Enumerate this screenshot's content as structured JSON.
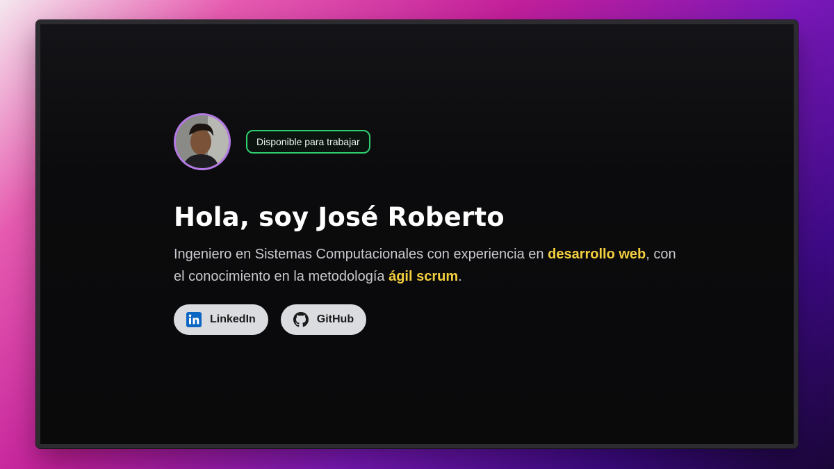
{
  "hero": {
    "availability_badge": "Disponible para trabajar",
    "title": "Hola, soy José Roberto",
    "description": {
      "part1": "Ingeniero en Sistemas Computacionales con experiencia en ",
      "highlight1": "desarrollo web",
      "part2": ", con el conocimiento en la metodología ",
      "highlight2": "ágil scrum",
      "part3": "."
    }
  },
  "links": [
    {
      "label": "LinkedIn",
      "icon": "linkedin-icon"
    },
    {
      "label": "GitHub",
      "icon": "github-icon"
    }
  ],
  "colors": {
    "accent_highlight": "#f4d03f",
    "badge_border": "#2fcf6f",
    "avatar_border": "#b57ae6",
    "window_background": "#0a0a0b"
  }
}
